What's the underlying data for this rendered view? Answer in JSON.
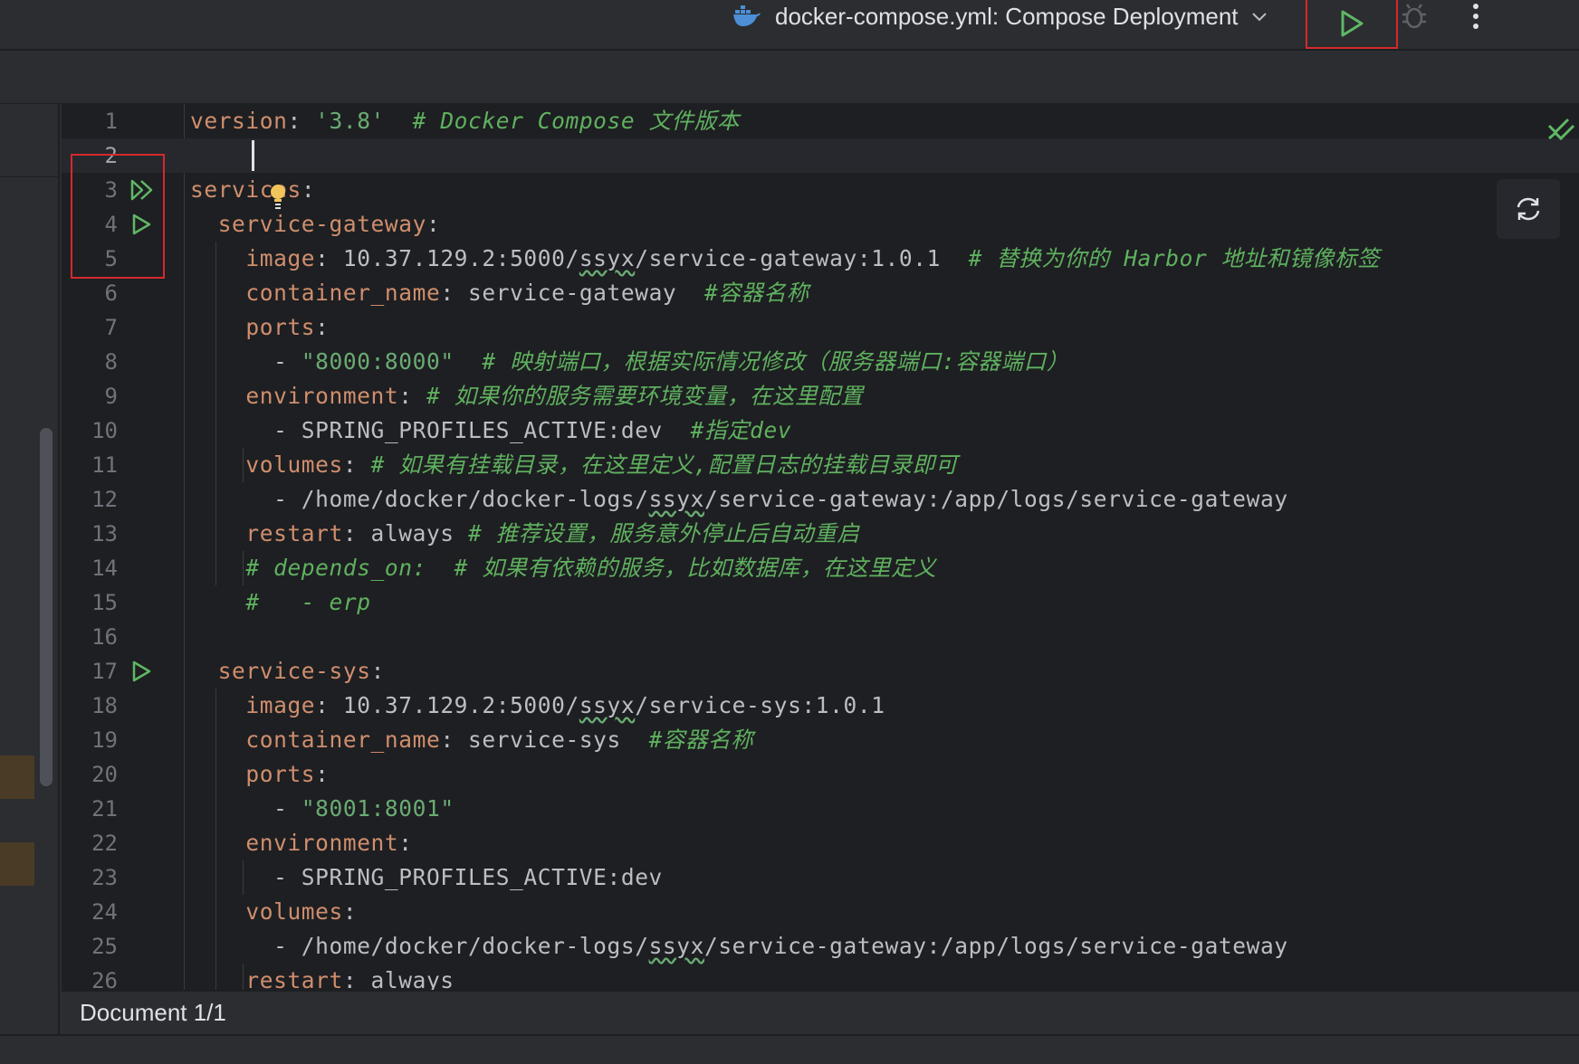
{
  "toolbar": {
    "run_config_label": "docker-compose.yml: Compose Deployment",
    "run_config_icon": "docker-icon",
    "run_button_icon": "play-icon",
    "debug_button_icon": "bug-icon",
    "more_button_icon": "more-vertical-icon"
  },
  "colors": {
    "key": "#cf8e6d",
    "string": "#6aab73",
    "comment": "#5fb15f",
    "run_green": "#5fb865",
    "highlight_red": "#d42a2a"
  },
  "editor": {
    "lines": [
      {
        "n": "1",
        "tokens": [
          [
            "k",
            "version"
          ],
          [
            "p",
            ": "
          ],
          [
            "s",
            "'3.8'"
          ],
          [
            "p",
            "  "
          ],
          [
            "c",
            "# Docker Compose 文件版本"
          ]
        ]
      },
      {
        "n": "2",
        "tokens": []
      },
      {
        "n": "3",
        "tokens": [
          [
            "k",
            "services"
          ],
          [
            "p",
            ":"
          ]
        ],
        "gutter_icon": "run-all-icon"
      },
      {
        "n": "4",
        "tokens": [
          [
            "p",
            "  "
          ],
          [
            "k",
            "service-gateway"
          ],
          [
            "p",
            ":"
          ]
        ],
        "gutter_icon": "run-icon"
      },
      {
        "n": "5",
        "tokens": [
          [
            "p",
            "    "
          ],
          [
            "k",
            "image"
          ],
          [
            "p",
            ": 10.37.129.2:5000/"
          ],
          [
            "u",
            "ssyx"
          ],
          [
            "p",
            "/service-gateway:1.0.1  "
          ],
          [
            "c",
            "# 替换为你的 Harbor 地址和镜像标签"
          ]
        ]
      },
      {
        "n": "6",
        "tokens": [
          [
            "p",
            "    "
          ],
          [
            "k",
            "container_name"
          ],
          [
            "p",
            ": service-gateway  "
          ],
          [
            "c",
            "#容器名称"
          ]
        ]
      },
      {
        "n": "7",
        "tokens": [
          [
            "p",
            "    "
          ],
          [
            "k",
            "ports"
          ],
          [
            "p",
            ":"
          ]
        ]
      },
      {
        "n": "8",
        "tokens": [
          [
            "p",
            "      - "
          ],
          [
            "s",
            "\"8000:8000\""
          ],
          [
            "p",
            "  "
          ],
          [
            "c",
            "# 映射端口，根据实际情况修改（服务器端口:容器端口）"
          ]
        ]
      },
      {
        "n": "9",
        "tokens": [
          [
            "p",
            "    "
          ],
          [
            "k",
            "environment"
          ],
          [
            "p",
            ": "
          ],
          [
            "c",
            "# 如果你的服务需要环境变量，在这里配置"
          ]
        ]
      },
      {
        "n": "10",
        "tokens": [
          [
            "p",
            "      - SPRING_PROFILES_ACTIVE:dev  "
          ],
          [
            "c",
            "#指定dev"
          ]
        ]
      },
      {
        "n": "11",
        "tokens": [
          [
            "p",
            "    "
          ],
          [
            "k",
            "volumes"
          ],
          [
            "p",
            ": "
          ],
          [
            "c",
            "# 如果有挂载目录，在这里定义,配置日志的挂载目录即可"
          ]
        ]
      },
      {
        "n": "12",
        "tokens": [
          [
            "p",
            "      - /home/docker/docker-logs/"
          ],
          [
            "u",
            "ssyx"
          ],
          [
            "p",
            "/service-gateway:/app/logs/service-gateway"
          ]
        ]
      },
      {
        "n": "13",
        "tokens": [
          [
            "p",
            "    "
          ],
          [
            "k",
            "restart"
          ],
          [
            "p",
            ": always "
          ],
          [
            "c",
            "# 推荐设置，服务意外停止后自动重启"
          ]
        ]
      },
      {
        "n": "14",
        "tokens": [
          [
            "p",
            "    "
          ],
          [
            "c",
            "# depends_on:  # 如果有依赖的服务，比如数据库，在这里定义"
          ]
        ]
      },
      {
        "n": "15",
        "tokens": [
          [
            "p",
            "    "
          ],
          [
            "c",
            "#   - erp"
          ]
        ]
      },
      {
        "n": "16",
        "tokens": []
      },
      {
        "n": "17",
        "tokens": [
          [
            "p",
            "  "
          ],
          [
            "k",
            "service-sys"
          ],
          [
            "p",
            ":"
          ]
        ],
        "gutter_icon": "run-icon"
      },
      {
        "n": "18",
        "tokens": [
          [
            "p",
            "    "
          ],
          [
            "k",
            "image"
          ],
          [
            "p",
            ": 10.37.129.2:5000/"
          ],
          [
            "u",
            "ssyx"
          ],
          [
            "p",
            "/service-sys:1.0.1"
          ]
        ]
      },
      {
        "n": "19",
        "tokens": [
          [
            "p",
            "    "
          ],
          [
            "k",
            "container_name"
          ],
          [
            "p",
            ": service-sys  "
          ],
          [
            "c",
            "#容器名称"
          ]
        ]
      },
      {
        "n": "20",
        "tokens": [
          [
            "p",
            "    "
          ],
          [
            "k",
            "ports"
          ],
          [
            "p",
            ":"
          ]
        ]
      },
      {
        "n": "21",
        "tokens": [
          [
            "p",
            "      - "
          ],
          [
            "s",
            "\"8001:8001\""
          ]
        ]
      },
      {
        "n": "22",
        "tokens": [
          [
            "p",
            "    "
          ],
          [
            "k",
            "environment"
          ],
          [
            "p",
            ":"
          ]
        ]
      },
      {
        "n": "23",
        "tokens": [
          [
            "p",
            "      - SPRING_PROFILES_ACTIVE:dev"
          ]
        ]
      },
      {
        "n": "24",
        "tokens": [
          [
            "p",
            "    "
          ],
          [
            "k",
            "volumes"
          ],
          [
            "p",
            ":"
          ]
        ]
      },
      {
        "n": "25",
        "tokens": [
          [
            "p",
            "      - /home/docker/docker-logs/"
          ],
          [
            "u",
            "ssyx"
          ],
          [
            "p",
            "/service-gateway:/app/logs/service-gateway"
          ]
        ]
      },
      {
        "n": "26",
        "tokens": [
          [
            "p",
            "    "
          ],
          [
            "k",
            "restart"
          ],
          [
            "p",
            ": always"
          ]
        ]
      }
    ],
    "current_line": "2",
    "inspection_icon": "check-icon",
    "reload_icon": "reload-icon",
    "bulb_icon": "bulb-icon"
  },
  "status": {
    "document": "Document 1/1"
  }
}
